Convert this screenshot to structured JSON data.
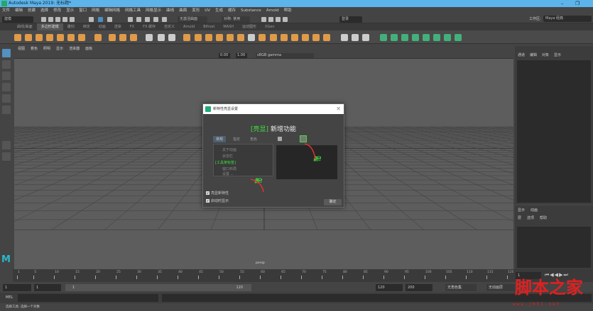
{
  "window": {
    "title": "Autodesk Maya 2019: 无标题*",
    "minimize": "–",
    "restore": "❐"
  },
  "menus": [
    "文件",
    "编辑",
    "创建",
    "选择",
    "修改",
    "显示",
    "窗口",
    "网格",
    "编辑网格",
    "网格工具",
    "网格显示",
    "曲线",
    "曲面",
    "变形",
    "UV",
    "生成",
    "缓存",
    "Substance",
    "Arnold",
    "帮助"
  ],
  "status": {
    "mode": "建模",
    "no_live_surface": "无激活曲面",
    "symmetry": "对称: 禁用",
    "login": "登录",
    "workspace_label": "工作区:",
    "workspace": "Maya 经典"
  },
  "shelf_tabs": [
    "曲线/曲面",
    "多边形建模",
    "雕刻",
    "绑定",
    "动画",
    "渲染",
    "FX",
    "FX 缓存",
    "自定义",
    "Arnold",
    "Bifrost",
    "MASH",
    "运动图形",
    "XGen"
  ],
  "shelf_active": 1,
  "viewport": {
    "menus": [
      "视图",
      "着色",
      "照明",
      "显示",
      "渲染器",
      "面板"
    ],
    "exposure": "0.00",
    "gamma": "1.00",
    "color_space": "sRGB gamma",
    "camera": "persp"
  },
  "channel_box": {
    "menus": [
      "通道",
      "编辑",
      "对象",
      "显示"
    ]
  },
  "layer_editor": {
    "tabs": [
      "显示",
      "动画"
    ],
    "menus": [
      "层",
      "选项",
      "帮助"
    ]
  },
  "timeline": {
    "ticks": [
      1,
      5,
      10,
      15,
      20,
      25,
      30,
      35,
      40,
      45,
      50,
      55,
      60,
      65,
      70,
      75,
      80,
      85,
      90,
      95,
      100,
      105,
      110,
      115,
      120
    ],
    "current_frame": "1"
  },
  "range": {
    "start": "1",
    "anim_start": "1",
    "slider_start": "1",
    "slider_end": "120",
    "end": "120",
    "anim_end": "200",
    "char_set": "无角色集",
    "anim_layer": "无动画层"
  },
  "mel": {
    "label": "MEL"
  },
  "help_line": "选择工具: 选择一个对象",
  "dialog": {
    "title": "新特性亮显设置",
    "close": "✕",
    "heading_bracket": "[亮显]",
    "heading": "新增功能",
    "tabs": [
      "常规",
      "指定",
      "角色"
    ],
    "list_items": [
      "关于动画",
      "状态栏",
      "[工具架标签]",
      "窗口布局",
      "设置 ..."
    ],
    "new_label": "新!",
    "check_highlight": "亮显新特性",
    "check_startup": "启动时显示",
    "ok": "确定"
  },
  "watermark": {
    "text": "脚本之家",
    "url": "www.jb51.net"
  }
}
